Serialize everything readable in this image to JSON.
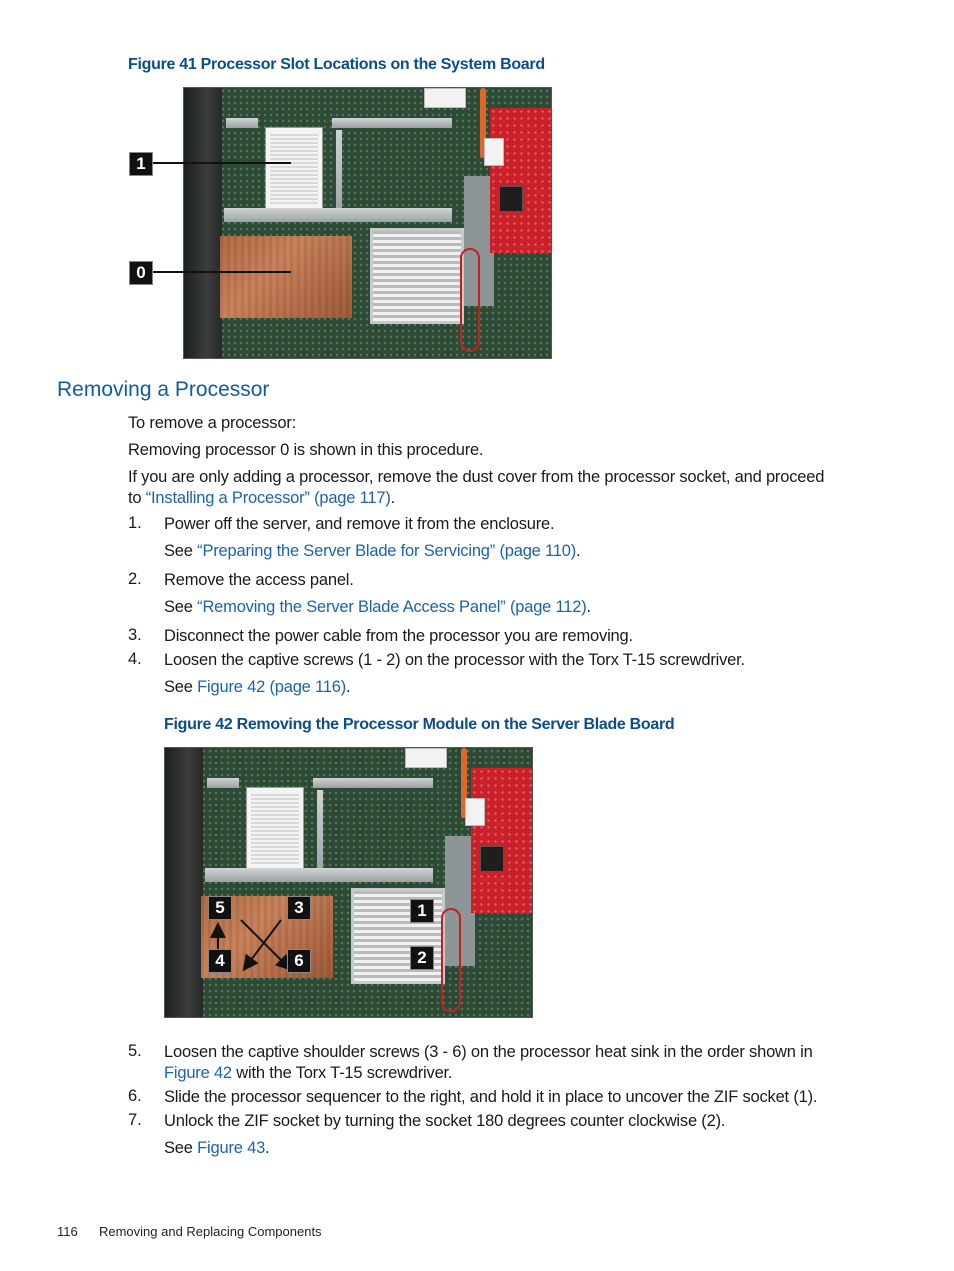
{
  "figure41": {
    "caption": "Figure 41 Processor Slot Locations on the System Board",
    "callouts": [
      "1",
      "0"
    ],
    "image_alt": "Processor slot locations on the system board"
  },
  "section": {
    "heading": "Removing a Processor",
    "intro": "To remove a processor:",
    "note": "Removing processor 0 is shown in this procedure.",
    "adding_line1": "If you are only adding a processor, remove the dust cover from the processor socket, and proceed",
    "adding_line2_prefix": "to ",
    "adding_link": "“Installing a Processor” (page 117)",
    "adding_suffix": "."
  },
  "steps": [
    {
      "num": "1.",
      "text": "Power off the server, and remove it from the enclosure.",
      "see_prefix": "See ",
      "see_link": "“Preparing the Server Blade for Servicing” (page 110)",
      "see_suffix": "."
    },
    {
      "num": "2.",
      "text": "Remove the access panel.",
      "see_prefix": "See ",
      "see_link": "“Removing the Server Blade Access Panel” (page 112)",
      "see_suffix": "."
    },
    {
      "num": "3.",
      "text": "Disconnect the power cable from the processor you are removing."
    },
    {
      "num": "4.",
      "text": "Loosen the captive screws (1 - 2) on the processor with the Torx T-15 screwdriver.",
      "see_prefix": "See ",
      "see_link": "Figure 42 (page 116)",
      "see_suffix": "."
    },
    {
      "num": "5.",
      "text_line1": "Loosen the captive shoulder screws (3 - 6) on the processor heat sink in the order shown in",
      "link": "Figure 42",
      "text_line2": " with the Torx T-15 screwdriver."
    },
    {
      "num": "6.",
      "text": "Slide the processor sequencer to the right, and hold it in place to uncover the ZIF socket (1)."
    },
    {
      "num": "7.",
      "text": "Unlock the ZIF socket by turning the socket 180 degrees counter clockwise (2).",
      "see_prefix": "See ",
      "see_link": "Figure 43",
      "see_suffix": "."
    }
  ],
  "figure42": {
    "caption": "Figure 42  Removing the Processor Module on the Server Blade Board",
    "callouts": [
      "5",
      "3",
      "4",
      "6",
      "1",
      "2"
    ],
    "image_alt": "Removing the processor module on the server blade board"
  },
  "footer": {
    "page_number": "116",
    "chapter": "Removing and Replacing Components"
  }
}
